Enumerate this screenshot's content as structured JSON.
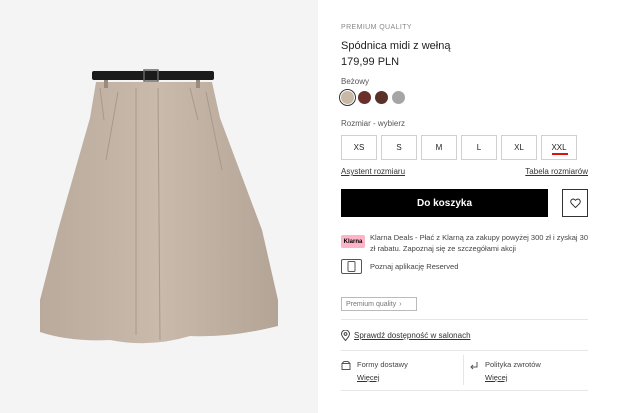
{
  "product": {
    "quality_badge": "PREMIUM QUALITY",
    "name": "Spódnica midi z wełną",
    "price": "179,99 PLN",
    "color_name": "Beżowy",
    "colors": [
      "#c9b8a3",
      "#6b2e2a",
      "#5a3128",
      "#a5a5a5"
    ],
    "size_label": "Rozmiar -  wybierz",
    "sizes": [
      "XS",
      "S",
      "M",
      "L",
      "XL",
      "XXL"
    ]
  },
  "links": {
    "size_assistant": "Asystent rozmiaru",
    "size_table": "Tabela rozmiarów"
  },
  "actions": {
    "add_to_cart": "Do koszyka"
  },
  "klarna": {
    "badge": "Klarna",
    "text": "Klarna Deals - Płać z Klarną za zakupy powyżej 300 zł i zyskaj 30 zł rabatu. Zapoznaj się ze szczegółami akcji"
  },
  "app": {
    "text": "Poznaj aplikację Reserved"
  },
  "premium_chip": "Premium quality",
  "store": {
    "text": "Sprawdź dostępność w salonach"
  },
  "info": {
    "delivery_title": "Formy dostawy",
    "delivery_more": "Więcej",
    "returns_title": "Polityka zwrotów",
    "returns_more": "Więcej"
  }
}
